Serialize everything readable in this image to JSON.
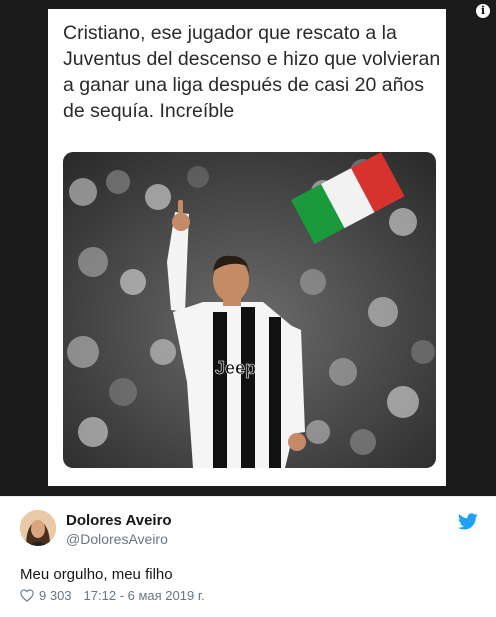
{
  "media": {
    "caption": "Cristiano, ese jugador que rescato a la Juventus del descenso e hizo que volvieran a ganar una liga después de casi 20 años de sequía. Increíble",
    "info_icon": "i",
    "shirt_sponsor": "Jeep"
  },
  "tweet": {
    "author_name": "Dolores Aveiro",
    "author_handle": "@DoloresAveiro",
    "text": "Meu orgulho, meu filho",
    "likes": "9 303",
    "timestamp": "17:12 - 6 мая 2019 г."
  },
  "colors": {
    "twitter_blue": "#1da1f2",
    "meta_gray": "#657786"
  },
  "icons": [
    "info-icon",
    "twitter-bird-icon",
    "heart-icon"
  ]
}
